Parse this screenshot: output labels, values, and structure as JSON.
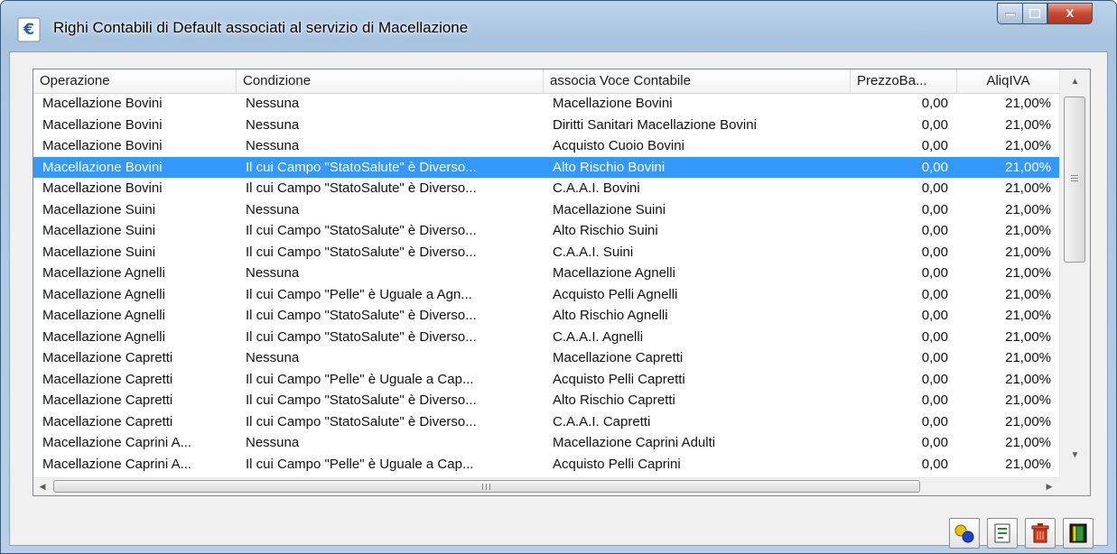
{
  "window": {
    "title": "Righi Contabili di Default associati al servizio di Macellazione",
    "close_label": "x"
  },
  "columns": [
    "Operazione",
    "Condizione",
    "associa Voce Contabile",
    "PrezzoBa...",
    "AliqIVA"
  ],
  "rows": [
    {
      "op": "Macellazione Bovini",
      "cond": "Nessuna",
      "voce": "Macellazione Bovini",
      "prezzo": "0,00",
      "iva": "21,00%"
    },
    {
      "op": "Macellazione Bovini",
      "cond": "Nessuna",
      "voce": "Diritti Sanitari Macellazione Bovini",
      "prezzo": "0,00",
      "iva": "21,00%"
    },
    {
      "op": "Macellazione Bovini",
      "cond": "Nessuna",
      "voce": "Acquisto Cuoio Bovini",
      "prezzo": "0,00",
      "iva": "21,00%"
    },
    {
      "op": "Macellazione Bovini",
      "cond": "Il cui Campo \"StatoSalute\" è Diverso...",
      "voce": "Alto Rischio Bovini",
      "prezzo": "0,00",
      "iva": "21,00%",
      "selected": true
    },
    {
      "op": "Macellazione Bovini",
      "cond": "Il cui Campo \"StatoSalute\" è Diverso...",
      "voce": "C.A.A.I. Bovini",
      "prezzo": "0,00",
      "iva": "21,00%"
    },
    {
      "op": "Macellazione Suini",
      "cond": "Nessuna",
      "voce": "Macellazione Suini",
      "prezzo": "0,00",
      "iva": "21,00%"
    },
    {
      "op": "Macellazione Suini",
      "cond": "Il cui Campo \"StatoSalute\" è Diverso...",
      "voce": "Alto Rischio Suini",
      "prezzo": "0,00",
      "iva": "21,00%"
    },
    {
      "op": "Macellazione Suini",
      "cond": "Il cui Campo \"StatoSalute\" è Diverso...",
      "voce": "C.A.A.I. Suini",
      "prezzo": "0,00",
      "iva": "21,00%"
    },
    {
      "op": "Macellazione Agnelli",
      "cond": "Nessuna",
      "voce": "Macellazione Agnelli",
      "prezzo": "0,00",
      "iva": "21,00%"
    },
    {
      "op": "Macellazione Agnelli",
      "cond": "Il cui Campo \"Pelle\" è Uguale a Agn...",
      "voce": "Acquisto Pelli Agnelli",
      "prezzo": "0,00",
      "iva": "21,00%"
    },
    {
      "op": "Macellazione Agnelli",
      "cond": "Il cui Campo \"StatoSalute\" è Diverso...",
      "voce": "Alto Rischio Agnelli",
      "prezzo": "0,00",
      "iva": "21,00%"
    },
    {
      "op": "Macellazione Agnelli",
      "cond": "Il cui Campo \"StatoSalute\" è Diverso...",
      "voce": "C.A.A.I. Agnelli",
      "prezzo": "0,00",
      "iva": "21,00%"
    },
    {
      "op": "Macellazione Capretti",
      "cond": "Nessuna",
      "voce": "Macellazione Capretti",
      "prezzo": "0,00",
      "iva": "21,00%"
    },
    {
      "op": "Macellazione Capretti",
      "cond": "Il cui Campo \"Pelle\" è Uguale a Cap...",
      "voce": "Acquisto Pelli Capretti",
      "prezzo": "0,00",
      "iva": "21,00%"
    },
    {
      "op": "Macellazione Capretti",
      "cond": "Il cui Campo \"StatoSalute\" è Diverso...",
      "voce": "Alto Rischio Capretti",
      "prezzo": "0,00",
      "iva": "21,00%"
    },
    {
      "op": "Macellazione Capretti",
      "cond": "Il cui Campo \"StatoSalute\" è Diverso...",
      "voce": "C.A.A.I. Capretti",
      "prezzo": "0,00",
      "iva": "21,00%"
    },
    {
      "op": "Macellazione Caprini A...",
      "cond": "Nessuna",
      "voce": "Macellazione Caprini Adulti",
      "prezzo": "0,00",
      "iva": "21,00%"
    },
    {
      "op": "Macellazione Caprini A...",
      "cond": "Il cui Campo \"Pelle\" è Uguale a Cap...",
      "voce": "Acquisto Pelli Caprini",
      "prezzo": "0,00",
      "iva": "21,00%"
    }
  ],
  "toolbar": {
    "buttons": [
      {
        "name": "add-record-icon"
      },
      {
        "name": "edit-record-icon"
      },
      {
        "name": "delete-record-icon"
      },
      {
        "name": "exit-door-icon"
      }
    ]
  },
  "colors": {
    "selection": "#3399ff",
    "title_bar": "#a9c4e0",
    "close_button": "#c9482e"
  }
}
